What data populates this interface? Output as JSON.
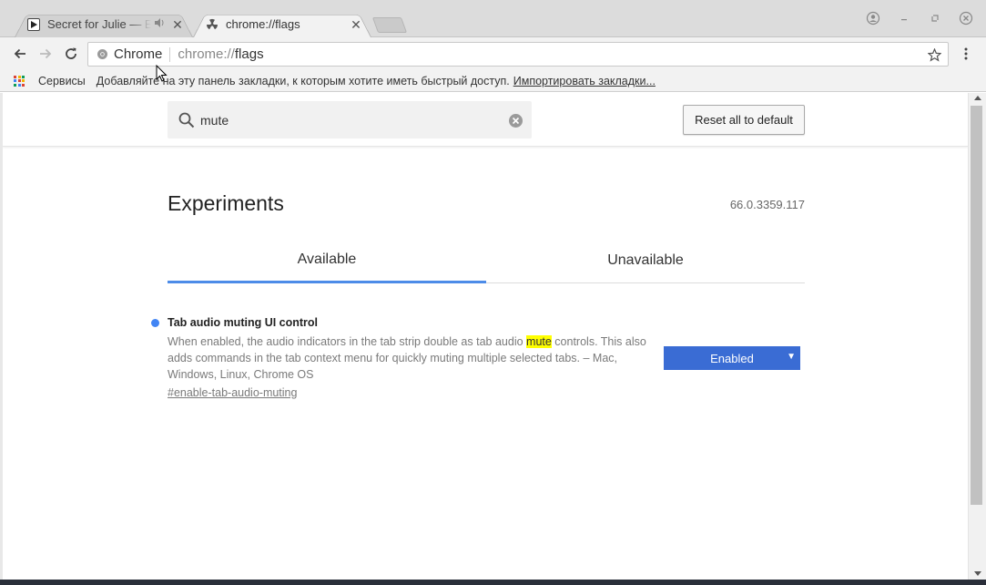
{
  "tabs": [
    {
      "title": "Secret for Julie — Eri",
      "favicon": "youtube-play-icon",
      "has_audio": true
    },
    {
      "title": "chrome://flags",
      "favicon": "radiation-icon",
      "has_audio": false
    }
  ],
  "toolbar": {
    "chip_label": "Chrome",
    "url_scheme": "chrome://",
    "url_path": "flags"
  },
  "bookmarks": {
    "apps_label": "Сервисы",
    "hint": "Добавляйте на эту панель закладки, к которым хотите иметь быстрый доступ.",
    "import_link": "Импортировать закладки..."
  },
  "flags_page": {
    "search": {
      "value": "mute",
      "placeholder": ""
    },
    "reset_label": "Reset all to default",
    "title": "Experiments",
    "version": "66.0.3359.117",
    "tabs": [
      {
        "label": "Available",
        "active": true
      },
      {
        "label": "Unavailable",
        "active": false
      }
    ],
    "flag": {
      "name": "Tab audio muting UI control",
      "desc_before": "When enabled, the audio indicators in the tab strip double as tab audio ",
      "desc_highlight": "mute",
      "desc_after": " controls. This also adds commands in the tab context menu for quickly muting multiple selected tabs. – Mac, Windows, Linux, Chrome OS",
      "link": "#enable-tab-audio-muting",
      "selected_option": "Enabled"
    }
  },
  "colors": {
    "accent": "#4d8ce8",
    "select_bg": "#3a6cd4",
    "highlight": "#ffff00",
    "flag_dot": "#4285f4"
  }
}
